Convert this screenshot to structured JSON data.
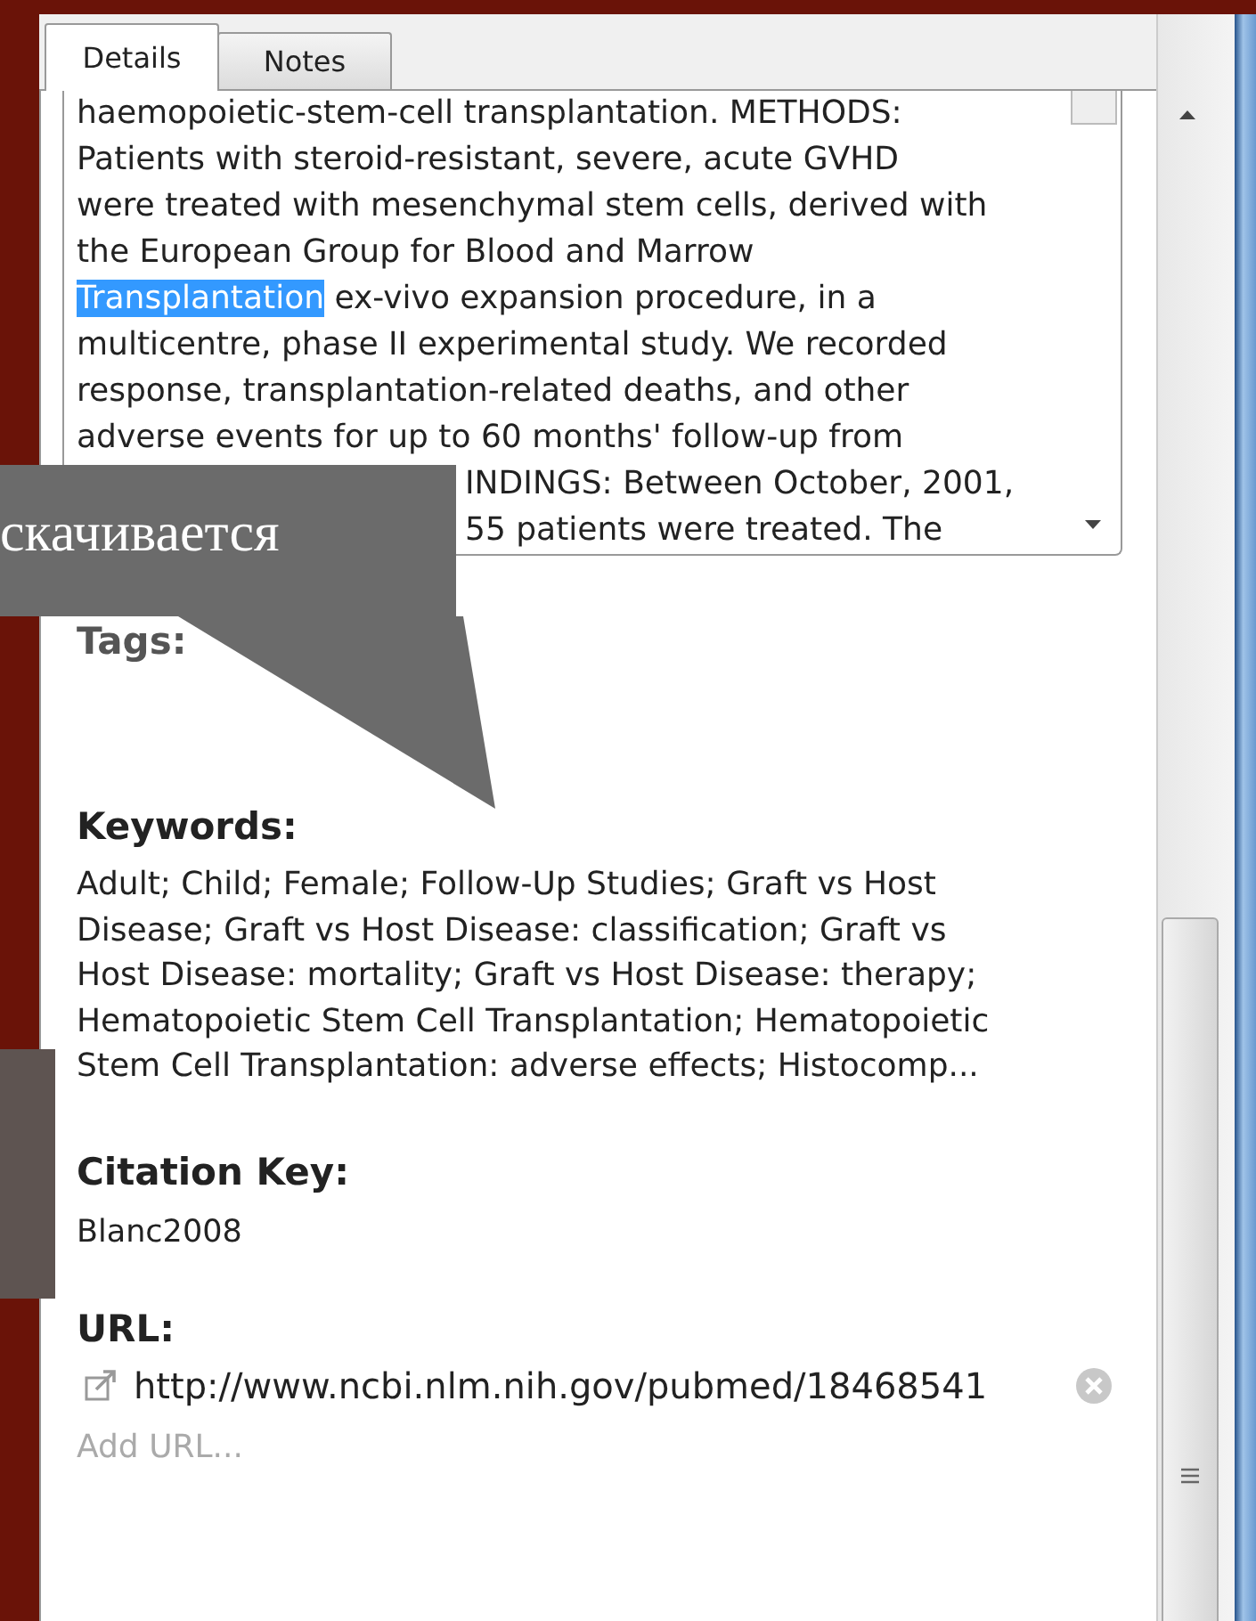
{
  "tabs": [
    {
      "label": "Details",
      "selected": true
    },
    {
      "label": "Notes",
      "selected": false
    }
  ],
  "abstract": {
    "lines": [
      {
        "covered": false,
        "segments": [
          {
            "text": "haemopoietic-stem-cell transplantation. METHODS:",
            "selected": false
          }
        ]
      },
      {
        "covered": false,
        "segments": [
          {
            "text": "Patients with steroid-resistant, severe, acute GVHD",
            "selected": false
          }
        ]
      },
      {
        "covered": false,
        "segments": [
          {
            "text": "were treated with mesenchymal stem cells, derived with",
            "selected": false
          }
        ]
      },
      {
        "covered": false,
        "segments": [
          {
            "text": "the European Group for Blood and Marrow",
            "selected": false
          }
        ]
      },
      {
        "covered": false,
        "segments": [
          {
            "text": "Transplantation",
            "selected": true
          },
          {
            "text": " ex-vivo expansion procedure, in a",
            "selected": false
          }
        ]
      },
      {
        "covered": false,
        "segments": [
          {
            "text": "multicentre, phase II experimental study. We recorded",
            "selected": false
          }
        ]
      },
      {
        "covered": false,
        "segments": [
          {
            "text": "response, transplantation-related deaths, and other",
            "selected": false
          }
        ]
      },
      {
        "covered": false,
        "segments": [
          {
            "text": "adverse events for up to 60 months' follow-up from",
            "selected": false
          }
        ]
      },
      {
        "covered": true,
        "segments": [
          {
            "text": "INDINGS: Between October, 2001,",
            "selected": false
          }
        ]
      },
      {
        "covered": true,
        "segments": [
          {
            "text": "55 patients were treated. The",
            "selected": false
          }
        ]
      }
    ]
  },
  "tags": {
    "label": "Tags:"
  },
  "keywords": {
    "label": "Keywords:",
    "lines": [
      "Adult; Child; Female; Follow-Up Studies; Graft vs Host",
      "Disease; Graft vs Host Disease: classification; Graft vs",
      "Host Disease: mortality; Graft vs Host Disease: therapy;",
      "Hematopoietic Stem Cell Transplantation; Hematopoietic",
      "Stem Cell Transplantation: adverse effects; Histocomp..."
    ]
  },
  "citation_key": {
    "label": "Citation Key:",
    "value": "Blanc2008"
  },
  "url": {
    "label": "URL:",
    "value": "http://www.ncbi.nlm.nih.gov/pubmed/18468541",
    "add": "Add URL..."
  },
  "callout": {
    "text": "скачивается"
  }
}
